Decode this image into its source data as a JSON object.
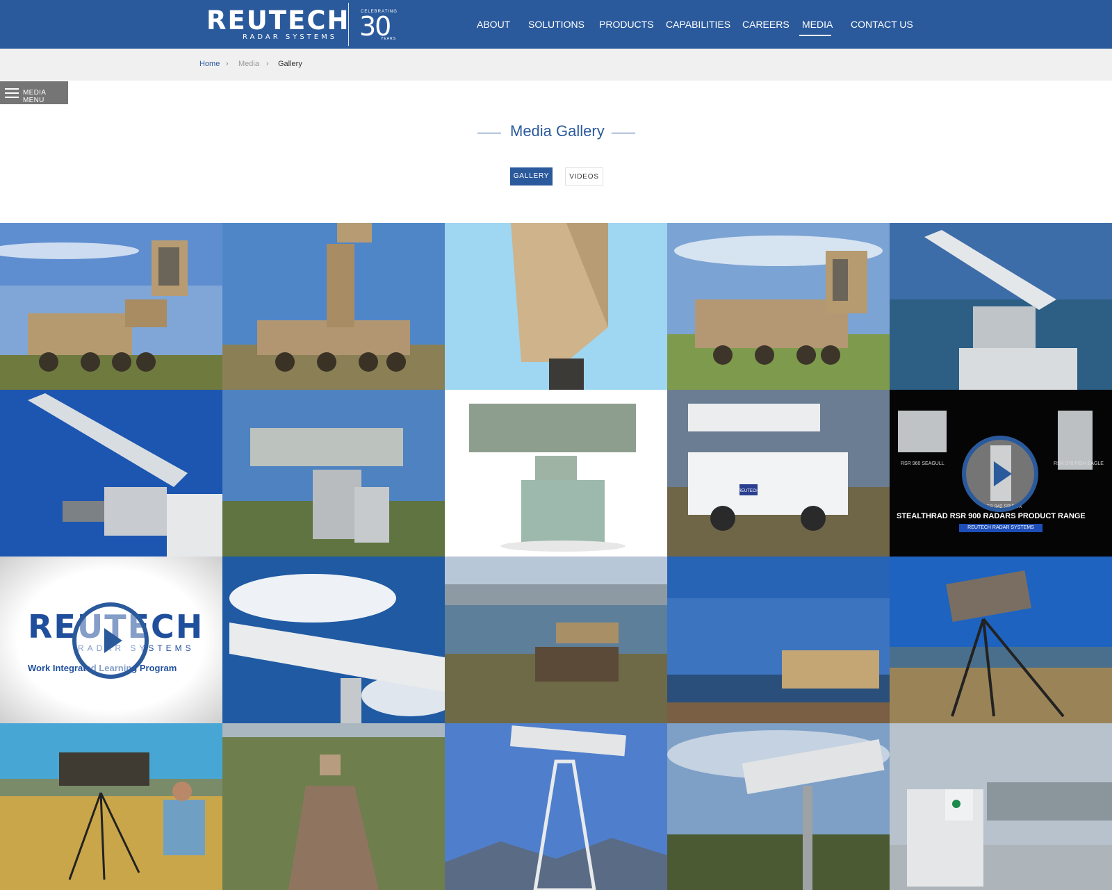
{
  "header": {
    "logo": {
      "word": "REUTECH",
      "sub": "RADAR SYSTEMS",
      "celebrating": "CELEBRATING",
      "number": "30",
      "years": "YEARS"
    },
    "nav": [
      "ABOUT",
      "SOLUTIONS",
      "PRODUCTS",
      "CAPABILITIES",
      "CAREERS",
      "MEDIA",
      "CONTACT US"
    ],
    "active_nav": "MEDIA"
  },
  "breadcrumb": {
    "home": "Home",
    "media": "Media",
    "current": "Gallery",
    "separator": "›"
  },
  "media_menu": {
    "label": "MEDIA MENU"
  },
  "page": {
    "title": "Media Gallery"
  },
  "tabs": {
    "gallery": "GALLERY",
    "videos": "VIDEOS",
    "active": "GALLERY"
  },
  "gallery": {
    "video_range": {
      "label_left": "RSR 960 SEAGULL",
      "label_right": "RSR 970 FISH-EAGLE",
      "label_center": "RSR 942 SPIDER",
      "title": "STEALTHRAD RSR 900 RADARS PRODUCT RANGE",
      "subtitle": "REUTECH RADAR SYSTEMS"
    },
    "video_wil": {
      "word": "REUTECH",
      "sub": "RADAR SYSTEMS",
      "caption": "Work Integrated Learning Program"
    },
    "truck_badge": "REUTECH"
  },
  "colors": {
    "brand_blue": "#2b5a9c",
    "breadcrumb_bg": "#f0f0f0",
    "menu_grey": "#757575"
  }
}
